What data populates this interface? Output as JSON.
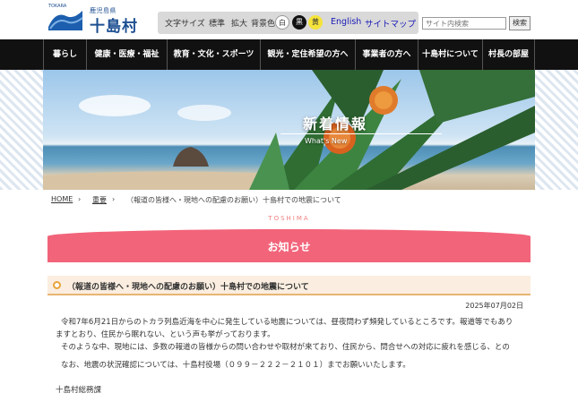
{
  "logo": {
    "tiny": "TOKARA",
    "prefecture": "鹿児島県",
    "village": "十島村"
  },
  "util": {
    "font_size_label": "文字サイズ",
    "standard": "標準",
    "enlarge": "拡大",
    "bg_color_label": "背景色",
    "bg_white": "白",
    "bg_black": "黒",
    "bg_yellow": "黄",
    "english": "English",
    "sitemap": "サイトマップ"
  },
  "search": {
    "placeholder": "サイト内検索",
    "button": "検索"
  },
  "nav": [
    "暮らし",
    "健康・医療・福祉",
    "教育・文化・スポーツ",
    "観光・定住希望の方へ",
    "事業者の方へ",
    "十島村について",
    "村長の部屋"
  ],
  "hero": {
    "title": "新着情報",
    "subtitle": "What's New"
  },
  "breadcrumb": {
    "home": "HOME",
    "sep": "›",
    "important": "重要",
    "current": "（報道の皆様へ・現地への配慮のお願い）十島村での地震について"
  },
  "section": {
    "kicker": "TOSHIMA",
    "title": "お知らせ"
  },
  "article": {
    "title": "（報道の皆様へ・現地への配慮のお願い）十島村での地震について",
    "date": "2025年07月02日",
    "lines": [
      "令和7年6月21日からのトカラ列島近海を中心に発生している地震については、昼夜問わず頻発しているところです。報道等でもあり",
      "ますとおり、住民から眠れない、という声も挙がっております。",
      "そのような中、現地には、多数の報道の皆様からの問い合わせや取材が来ており、住民から、問合せへの対応に疲れを感じる、との",
      "なお、地震の状況確認については、十島村役場（０９９－２２２－２１０１）までお願いいたします。",
      "十島村総務課"
    ]
  },
  "colors": {
    "nav_bg": "#111111",
    "accent_pink": "#f2647a",
    "brand_blue": "#1d4f91"
  }
}
